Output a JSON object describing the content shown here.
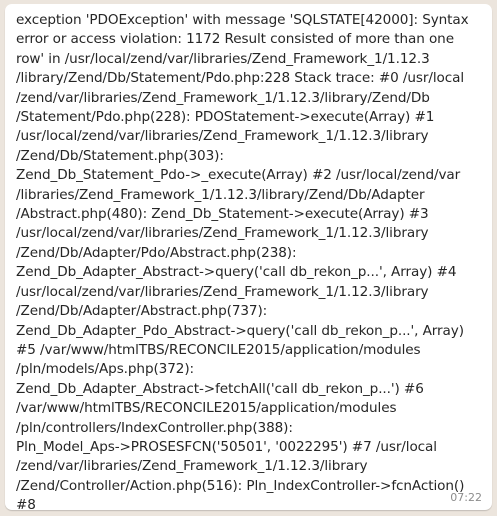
{
  "chat": {
    "message_lines": [
      "exception 'PDOException' with message 'SQLSTATE[42000]: Syntax",
      "error or access violation: 1172 Result consisted of more than one",
      "row' in /usr/local/zend/var/libraries/Zend_Framework_1/1.12.3",
      "/library/Zend/Db/Statement/Pdo.php:228 Stack trace: #0 /usr/local",
      "/zend/var/libraries/Zend_Framework_1/1.12.3/library/Zend/Db",
      "/Statement/Pdo.php(228): PDOStatement->execute(Array) #1",
      "/usr/local/zend/var/libraries/Zend_Framework_1/1.12.3/library",
      "/Zend/Db/Statement.php(303):",
      "Zend_Db_Statement_Pdo->_execute(Array) #2 /usr/local/zend/var",
      "/libraries/Zend_Framework_1/1.12.3/library/Zend/Db/Adapter",
      "/Abstract.php(480): Zend_Db_Statement->execute(Array) #3",
      "/usr/local/zend/var/libraries/Zend_Framework_1/1.12.3/library",
      "/Zend/Db/Adapter/Pdo/Abstract.php(238):",
      "Zend_Db_Adapter_Abstract->query('call db_rekon_p...', Array) #4",
      "/usr/local/zend/var/libraries/Zend_Framework_1/1.12.3/library",
      "/Zend/Db/Adapter/Abstract.php(737):",
      "Zend_Db_Adapter_Pdo_Abstract->query('call db_rekon_p...', Array)",
      "#5 /var/www/htmlTBS/RECONCILE2015/application/modules",
      "/pln/models/Aps.php(372):",
      "Zend_Db_Adapter_Abstract->fetchAll('call db_rekon_p...') #6",
      "/var/www/htmlTBS/RECONCILE2015/application/modules",
      "/pln/controllers/IndexController.php(388):",
      "Pln_Model_Aps->PROSESFCN('50501', '0022295') #7 /usr/local",
      "/zend/var/libraries/Zend_Framework_1/1.12.3/library",
      "/Zend/Controller/Action.php(516): Pln_IndexController->fcnAction()",
      "#8"
    ],
    "timestamp": "07:22"
  }
}
